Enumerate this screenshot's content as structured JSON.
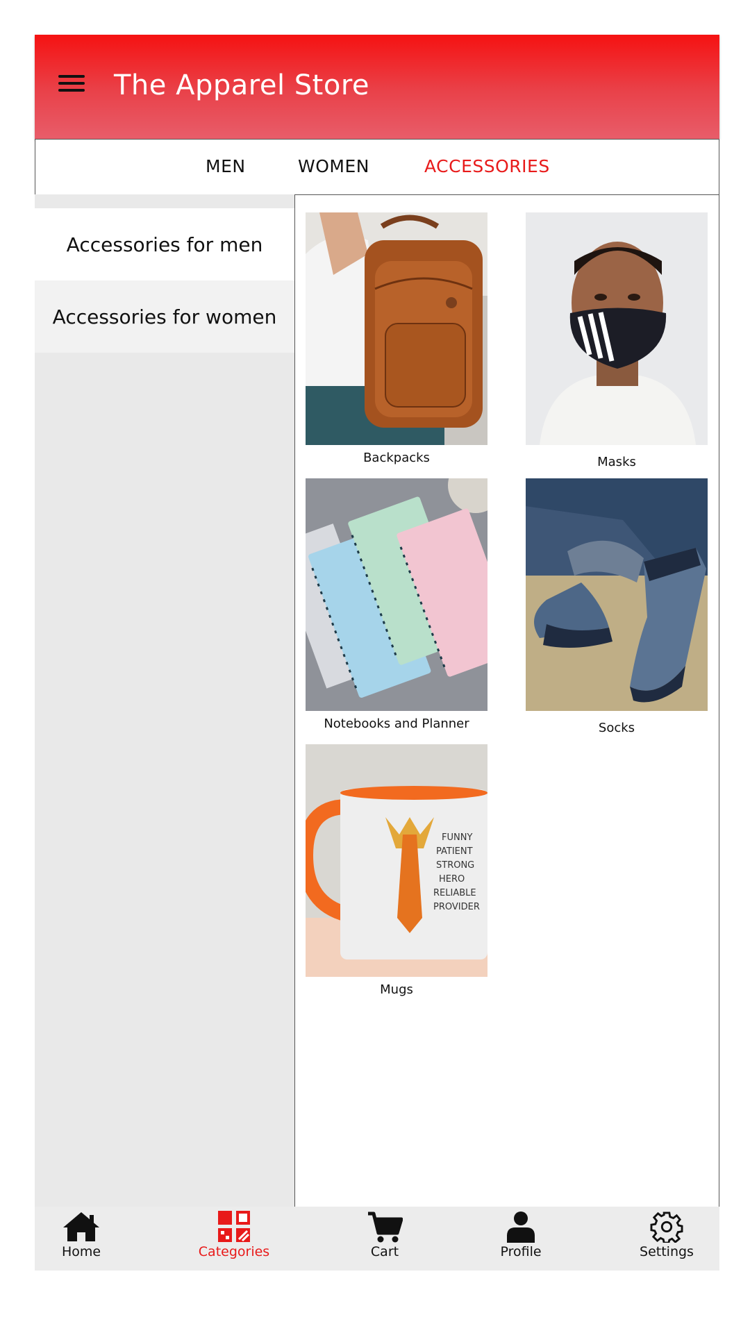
{
  "header": {
    "title": "The Apparel Store",
    "menu_icon": "hamburger-menu-icon"
  },
  "tabs": [
    {
      "label": "MEN",
      "active": false
    },
    {
      "label": "WOMEN",
      "active": false
    },
    {
      "label": "ACCESSORIES",
      "active": true
    }
  ],
  "sidebar": {
    "items": [
      {
        "label": "Accessories for men",
        "selected": true
      },
      {
        "label": "Accessories for women",
        "selected": false
      }
    ]
  },
  "products": [
    {
      "name": "Backpacks",
      "image": "backpack-image"
    },
    {
      "name": "Masks",
      "image": "mask-image"
    },
    {
      "name": "Notebooks and Planner",
      "image": "notebooks-image"
    },
    {
      "name": "Socks",
      "image": "socks-image"
    },
    {
      "name": "Mugs",
      "image": "mug-image"
    }
  ],
  "mug_print": [
    "FUNNY",
    "PATIENT",
    "STRONG",
    "HERO",
    "RELIABLE",
    "PROVIDER"
  ],
  "bottom_nav": [
    {
      "label": "Home",
      "icon": "home-icon",
      "active": false
    },
    {
      "label": "Categories",
      "icon": "categories-icon",
      "active": true
    },
    {
      "label": "Cart",
      "icon": "cart-icon",
      "active": false
    },
    {
      "label": "Profile",
      "icon": "profile-icon",
      "active": false
    },
    {
      "label": "Settings",
      "icon": "settings-icon",
      "active": false
    }
  ],
  "colors": {
    "accent": "#e81a1a",
    "header_top": "#f51212",
    "header_bottom": "#e85d6a",
    "sidebar_bg": "#e9e9e9"
  }
}
